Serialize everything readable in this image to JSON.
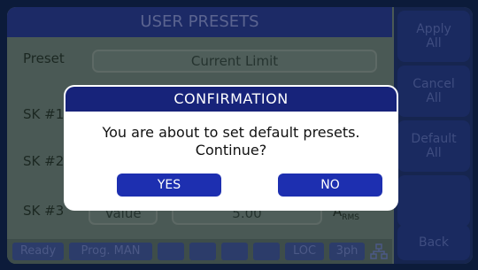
{
  "title": "USER PRESETS",
  "preset": {
    "label": "Preset",
    "value": "Current Limit"
  },
  "rows": [
    {
      "label": "SK #1"
    },
    {
      "label": "SK #2"
    },
    {
      "label": "SK #3",
      "mode": "Value",
      "value": "5.00",
      "unit": "A",
      "unit_sub": "RMS"
    }
  ],
  "sidebar": {
    "apply_all": [
      "Apply",
      "All"
    ],
    "cancel_all": [
      "Cancel",
      "All"
    ],
    "default_all": [
      "Default",
      "All"
    ],
    "back": "Back"
  },
  "status": {
    "ready": "Ready",
    "prog": "Prog. MAN",
    "loc": "LOC",
    "phase": "3ph",
    "network_icon": "network-icon"
  },
  "dialog": {
    "title": "CONFIRMATION",
    "line1": "You are about to set default presets.",
    "line2": "Continue?",
    "yes": "YES",
    "no": "NO"
  },
  "colors": {
    "dialog_header": "#17237a",
    "dialog_button": "#1d2fb0",
    "screen_bg": "#4a5955"
  }
}
